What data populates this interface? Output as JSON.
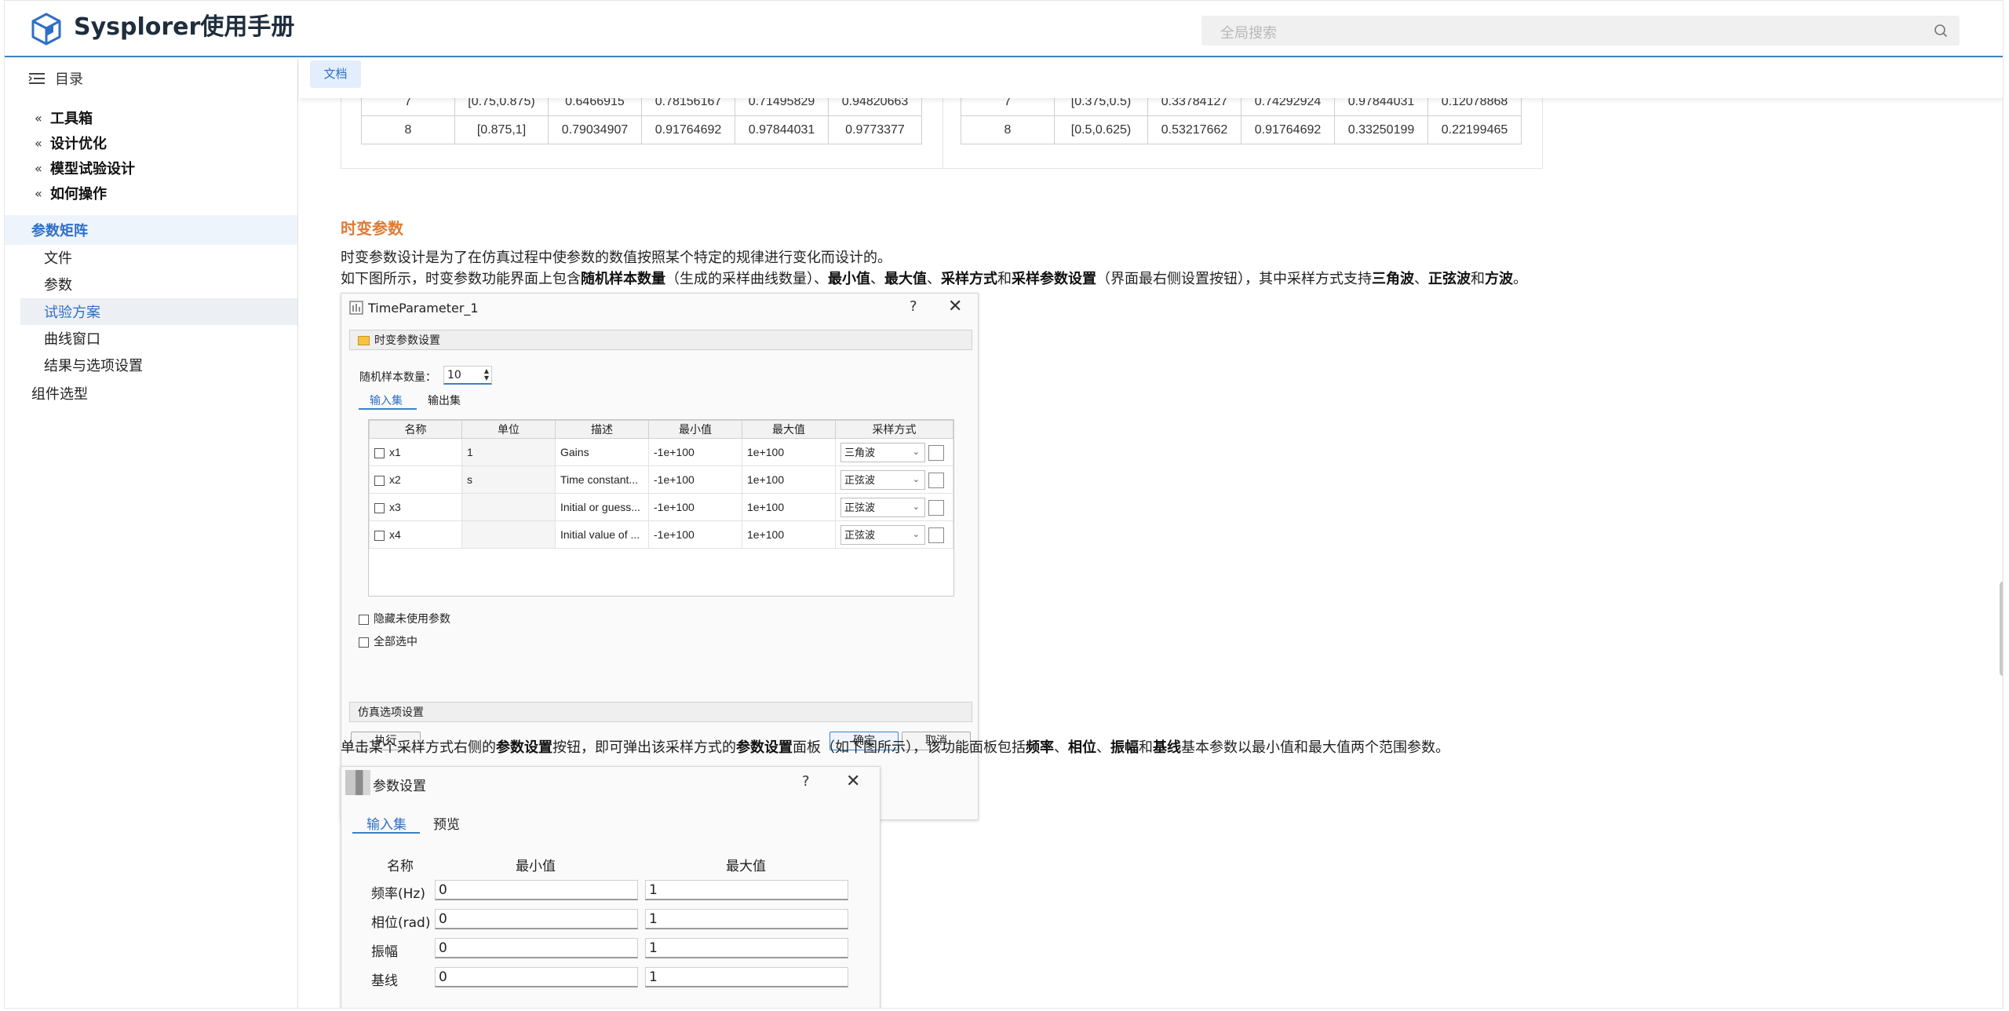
{
  "header": {
    "title": "Sysplorer使用手册",
    "search_placeholder": "全局搜索"
  },
  "sidebar": {
    "toc_label": "目录",
    "groups": [
      "工具箱",
      "设计优化",
      "模型试验设计",
      "如何操作"
    ],
    "active_group": "参数矩阵",
    "items": [
      "文件",
      "参数",
      "试验方案",
      "曲线窗口",
      "结果与选项设置"
    ],
    "selected_item": "试验方案",
    "bottom_item": "组件选型"
  },
  "tabs": {
    "doc_tab": "文档"
  },
  "top_table_left": {
    "rows": [
      [
        "7",
        "[0.75,0.875)",
        "0.6466915",
        "0.78156167",
        "0.71495829",
        "0.94820663"
      ],
      [
        "8",
        "[0.875,1]",
        "0.79034907",
        "0.91764692",
        "0.97844031",
        "0.9773377"
      ]
    ]
  },
  "top_table_right": {
    "rows": [
      [
        "7",
        "[0.375,0.5)",
        "0.33784127",
        "0.74292924",
        "0.97844031",
        "0.12078868"
      ],
      [
        "8",
        "[0.5,0.625)",
        "0.53217662",
        "0.91764692",
        "0.33250199",
        "0.22199465"
      ]
    ]
  },
  "section": {
    "heading": "时变参数",
    "p1": "时变参数设计是为了在仿真过程中使参数的数值按照某个特定的规律进行变化而设计的。",
    "p2": {
      "t1": "如下图所示，时变参数功能界面上包含",
      "b1": "随机样本数量",
      "t2": "（生成的采样曲线数量）、",
      "b2": "最小值",
      "t3": "、",
      "b3": "最大值",
      "t4": "、",
      "b4": "采样方式",
      "t5": "和",
      "b5": "采样参数设置",
      "t6": "（界面最右侧设置按钮），其中采样方式支持",
      "b6": "三角波",
      "t7": "、",
      "b7": "正弦波",
      "t8": "和",
      "b8": "方波",
      "t9": "。"
    },
    "p3": {
      "t1": "单击某个采样方式右侧的",
      "b1": "参数设置",
      "t2": "按钮，即可弹出该采样方式的",
      "b2": "参数设置",
      "t3": "面板（如下图所示），该功能面板包括",
      "b3": "频率",
      "t4": "、",
      "b4": "相位",
      "t5": "、",
      "b5": "振幅",
      "t6": "和",
      "b6": "基线",
      "t7": "基本参数以最小值和最大值两个范围参数。"
    }
  },
  "dialog1": {
    "title": "TimeParameter_1",
    "help": "?",
    "close": "✕",
    "group_title": "时变参数设置",
    "sample_label": "随机样本数量：",
    "sample_value": "10",
    "tabs": [
      "输入集",
      "输出集"
    ],
    "columns": [
      "名称",
      "单位",
      "描述",
      "最小值",
      "最大值",
      "采样方式"
    ],
    "rows": [
      {
        "name": "x1",
        "unit": "1",
        "desc": "Gains",
        "min": "-1e+100",
        "max": "1e+100",
        "mode": "三角波"
      },
      {
        "name": "x2",
        "unit": "s",
        "desc": "Time constant...",
        "min": "-1e+100",
        "max": "1e+100",
        "mode": "正弦波"
      },
      {
        "name": "x3",
        "unit": "",
        "desc": "Initial or guess...",
        "min": "-1e+100",
        "max": "1e+100",
        "mode": "正弦波"
      },
      {
        "name": "x4",
        "unit": "",
        "desc": "Initial value of ...",
        "min": "-1e+100",
        "max": "1e+100",
        "mode": "正弦波"
      }
    ],
    "hide_unused": "隐藏未使用参数",
    "select_all": "全部选中",
    "sim_options": "仿真选项设置",
    "run": "执行",
    "ok": "确定",
    "cancel": "取消"
  },
  "dialog2": {
    "title": "参数设置",
    "help": "?",
    "close": "✕",
    "tabs": [
      "输入集",
      "预览"
    ],
    "col_name": "名称",
    "col_min": "最小值",
    "col_max": "最大值",
    "rows": [
      {
        "label": "频率(Hz)",
        "min": "0",
        "max": "1"
      },
      {
        "label": "相位(rad)",
        "min": "0",
        "max": "1"
      },
      {
        "label": "振幅",
        "min": "0",
        "max": "1"
      },
      {
        "label": "基线",
        "min": "0",
        "max": "1"
      }
    ]
  },
  "colors": {
    "accent": "#3b82c4",
    "heading_orange": "#e07a33",
    "tab_bg": "#e3eefc"
  }
}
